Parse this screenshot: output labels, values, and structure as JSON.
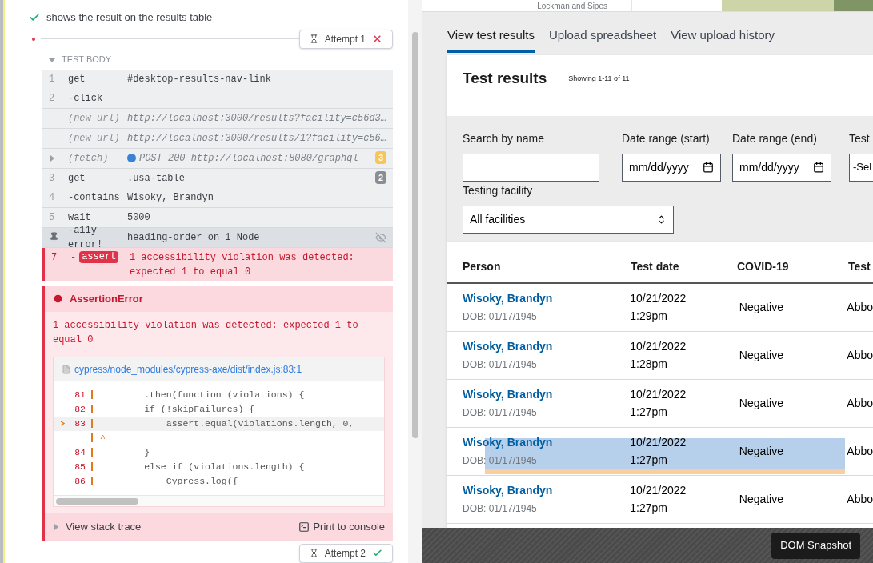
{
  "test": {
    "title": "shows the result on the results table",
    "passed": true
  },
  "attempts": [
    {
      "label": "Attempt 1",
      "passed": false
    },
    {
      "label": "Attempt 2",
      "passed": true
    }
  ],
  "test_body": {
    "label": "TEST BODY",
    "expanded": true
  },
  "command_groups": [
    {
      "commands": [
        {
          "kind": "command",
          "number": "1",
          "name": "get",
          "message": "#desktop-results-nav-link"
        },
        {
          "kind": "command",
          "number": "2",
          "name": "-click"
        }
      ]
    },
    {
      "commands": [
        {
          "kind": "event",
          "name": "(new url)",
          "message": "http://localhost:3000/results?facility=c56d3…"
        }
      ]
    },
    {
      "commands": [
        {
          "kind": "event",
          "name": "(new url)",
          "message": "http://localhost:3000/results/1?facility=c56…"
        }
      ]
    },
    {
      "commands": [
        {
          "kind": "event",
          "name": "(fetch)",
          "expandable": true,
          "color": "#3b82d6",
          "message": "POST 200 http://localhost:8080/graphql",
          "badge": {
            "text": "3",
            "color": "#f7c55a"
          }
        }
      ]
    },
    {
      "commands": [
        {
          "kind": "command",
          "number": "3",
          "name": "get",
          "message": ".usa-table",
          "badge": {
            "text": "2",
            "color": "#8a8d93"
          }
        },
        {
          "kind": "command",
          "number": "4",
          "name": "-contains",
          "message": "Wisoky, Brandyn"
        }
      ]
    },
    {
      "commands": [
        {
          "kind": "command",
          "number": "5",
          "name": "wait",
          "message": "5000"
        }
      ]
    },
    {
      "commands": [
        {
          "kind": "pinned",
          "name": "-a11y error!",
          "message": "heading-order on 1 Node"
        }
      ]
    },
    {
      "commands": [
        {
          "kind": "failed",
          "number": "7",
          "name": "-",
          "tag": "assert",
          "message": "1 accessibility violation was detected: expected 1 to equal 0"
        }
      ]
    }
  ],
  "error": {
    "title": "AssertionError",
    "message": "1 accessibility violation was detected: expected 1 to equal 0",
    "file": "cypress/node_modules/cypress-axe/dist/index.js:83:1",
    "code_lines": [
      {
        "kind": "line",
        "number": "81",
        "code": "        .then(function (violations) {",
        "current": false
      },
      {
        "kind": "line",
        "number": "82",
        "code": "        if (!skipFailures) {",
        "current": false
      },
      {
        "kind": "line",
        "number": "83",
        "code": "            assert.equal(violations.length, 0,",
        "current": true
      },
      {
        "kind": "caret",
        "code": "^"
      },
      {
        "kind": "line",
        "number": "84",
        "code": "        }",
        "current": false
      },
      {
        "kind": "line",
        "number": "85",
        "code": "        else if (violations.length) {",
        "current": false
      },
      {
        "kind": "line",
        "number": "86",
        "code": "            Cypress.log({",
        "current": false
      }
    ],
    "stack_trace": "View stack trace",
    "print": "Print to console"
  },
  "app": {
    "header_text": "Lockman and Sipes",
    "tabs": [
      {
        "label": "View test results",
        "selected": true
      },
      {
        "label": "Upload spreadsheet",
        "selected": false
      },
      {
        "label": "View upload history",
        "selected": false
      }
    ],
    "title": "Test results",
    "count": "Showing 1-11 of 11",
    "filters": [
      {
        "kind": "text",
        "label": "Search by name"
      },
      {
        "kind": "date",
        "label": "Date range (start)",
        "placeholder": "mm/dd/yyyy"
      },
      {
        "kind": "date",
        "label": "Date range (end)",
        "placeholder": "mm/dd/yyyy"
      },
      {
        "kind": "select",
        "label": "Test",
        "value": "-Sel"
      }
    ],
    "facility": {
      "label": "Testing facility",
      "value": "All facilities"
    },
    "columns": [
      "Person",
      "Test date",
      "COVID-19",
      "Test"
    ],
    "rows": [
      {
        "name": "Wisoky, Brandyn",
        "dob": "DOB: 01/17/1945",
        "date": "10/21/2022",
        "time": "1:29pm",
        "result": "Negative",
        "column_4": "Abbo",
        "highlighted": false
      },
      {
        "name": "Wisoky, Brandyn",
        "dob": "DOB: 01/17/1945",
        "date": "10/21/2022",
        "time": "1:28pm",
        "result": "Negative",
        "column_4": "Abbo",
        "highlighted": false
      },
      {
        "name": "Wisoky, Brandyn",
        "dob": "DOB: 01/17/1945",
        "date": "10/21/2022",
        "time": "1:27pm",
        "result": "Negative",
        "column_4": "Abbo",
        "highlighted": false
      },
      {
        "name": "Wisoky, Brandyn",
        "dob": "DOB: 01/17/1945",
        "date": "10/21/2022",
        "time": "1:27pm",
        "result": "Negative",
        "column_4": "Abbo",
        "highlighted": true
      },
      {
        "name": "Wisoky, Brandyn",
        "dob": "DOB: 01/17/1945",
        "date": "10/21/2022",
        "time": "1:27pm",
        "result": "Negative",
        "column_4": "Abbo",
        "highlighted": false
      }
    ]
  },
  "snapshot_button": "DOM Snapshot"
}
